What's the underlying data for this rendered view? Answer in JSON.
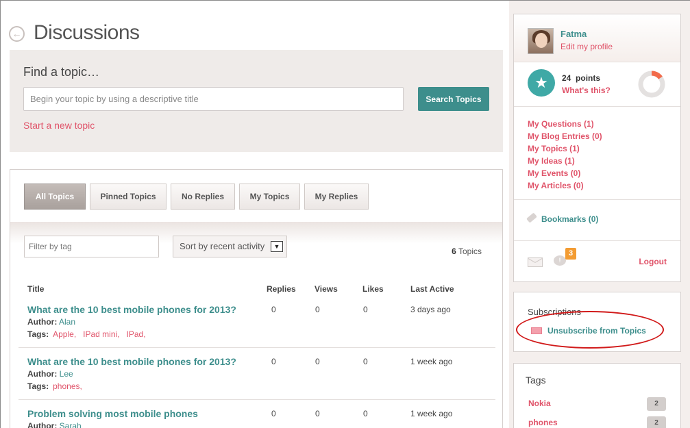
{
  "header": {
    "title": "Discussions"
  },
  "find": {
    "label": "Find a topic…",
    "search_placeholder": "Begin your topic by using a descriptive title",
    "search_button": "Search Topics",
    "new_topic_link": "Start a new topic"
  },
  "tabs": [
    {
      "label": "All Topics",
      "active": true
    },
    {
      "label": "Pinned Topics",
      "active": false
    },
    {
      "label": "No Replies",
      "active": false
    },
    {
      "label": "My Topics",
      "active": false
    },
    {
      "label": "My Replies",
      "active": false
    }
  ],
  "filters": {
    "tag_placeholder": "Filter by tag",
    "sort_value": "Sort by recent activity",
    "count_number": "6",
    "count_label": " Topics"
  },
  "columns": {
    "title": "Title",
    "replies": "Replies",
    "views": "Views",
    "likes": "Likes",
    "last_active": "Last Active"
  },
  "topics": [
    {
      "title": "What are the 10 best mobile phones for 2013?",
      "author_label": "Author:",
      "author": "Alan",
      "tags_label": "Tags:",
      "tags": [
        "Apple,",
        "IPad mini,",
        "IPad,"
      ],
      "replies": "0",
      "views": "0",
      "likes": "0",
      "last_active": "3 days ago"
    },
    {
      "title": "What are the 10 best mobile phones for 2013?",
      "author_label": "Author:",
      "author": "Lee",
      "tags_label": "Tags:",
      "tags": [
        "phones,"
      ],
      "replies": "0",
      "views": "0",
      "likes": "0",
      "last_active": "1 week ago"
    },
    {
      "title": "Problem solving most mobile phones",
      "author_label": "Author:",
      "author": "Sarah",
      "replies": "0",
      "views": "0",
      "likes": "0",
      "last_active": "1 week ago"
    }
  ],
  "profile": {
    "name": "Fatma",
    "edit_link": "Edit my profile",
    "points_value": "24",
    "points_label": "points",
    "whats_this": "What's this?",
    "donut_fraction": 0.15,
    "accent": "#f26b4b",
    "links": [
      "My Questions (1)",
      "My Blog Entries (0)",
      "My Topics (1)",
      "My Ideas (1)",
      "My Events (0)",
      "My Articles (0)"
    ],
    "bookmarks": "Bookmarks (0)",
    "notification_count": "3",
    "logout": "Logout"
  },
  "subscriptions": {
    "title": "Subscriptions",
    "unsubscribe": "Unsubscribe from Topics"
  },
  "tags_panel": {
    "title": "Tags",
    "items": [
      {
        "name": "Nokia",
        "count": "2"
      },
      {
        "name": "phones",
        "count": "2"
      }
    ]
  }
}
